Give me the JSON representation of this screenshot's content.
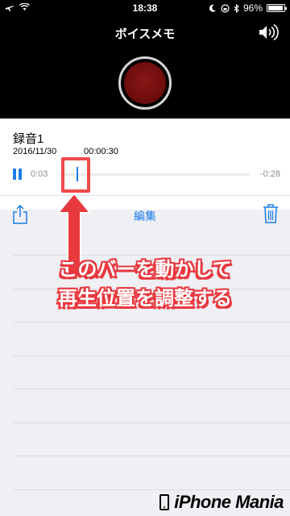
{
  "status_bar": {
    "time": "18:38",
    "battery_text": "96%",
    "battery_level": 0.96
  },
  "header": {
    "title": "ボイスメモ"
  },
  "recording": {
    "name": "録音1",
    "date": "2016/11/30",
    "duration": "00:00:30",
    "elapsed": "0:03",
    "remaining": "-0:28",
    "progress": 0.1
  },
  "toolbar": {
    "edit_label": "編集"
  },
  "annotation": {
    "line1": "このバーを動かして",
    "line2": "再生位置を調整する"
  },
  "watermark": {
    "brand": "iPhone Mania"
  },
  "colors": {
    "accent": "#1a7ce8",
    "record": "#7a1010",
    "annotation": "#e8393f"
  }
}
